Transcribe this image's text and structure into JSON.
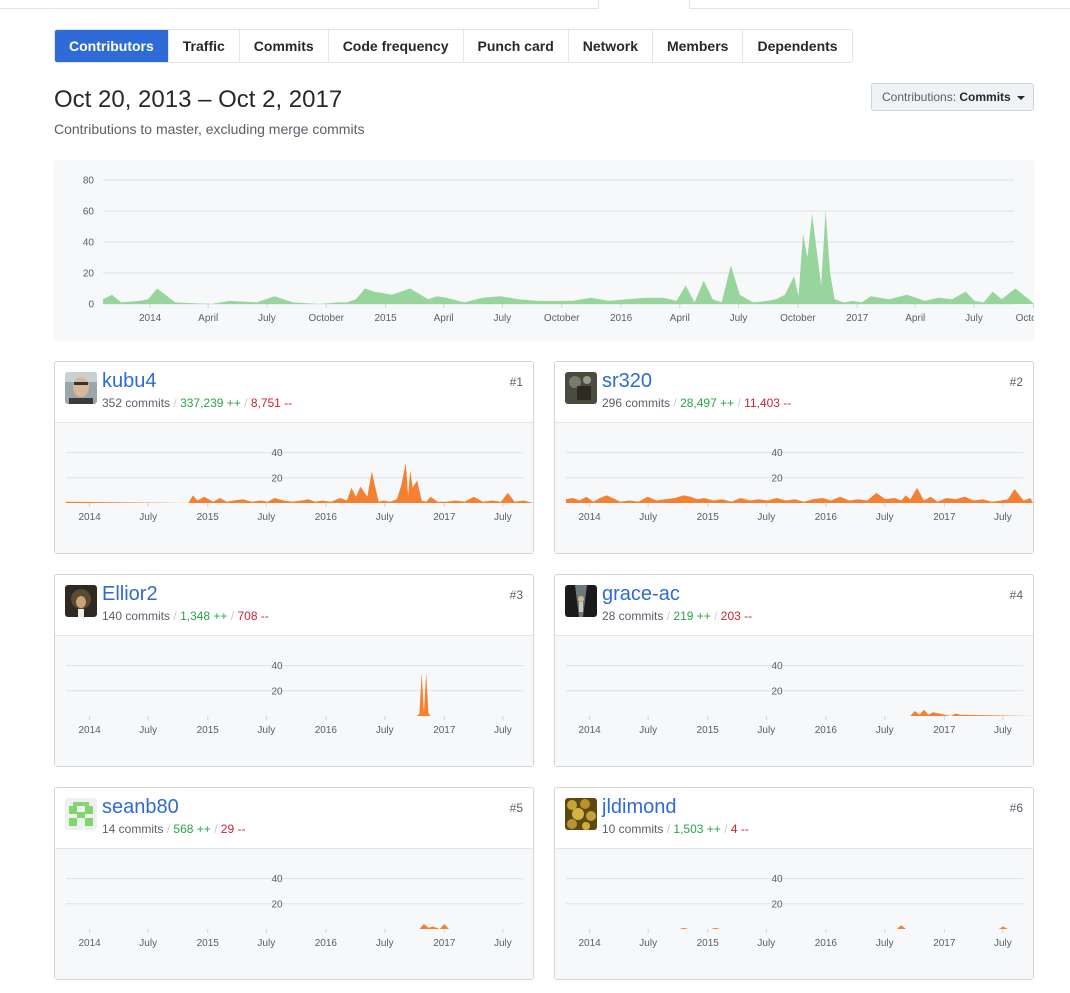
{
  "tabs": [
    {
      "label": "Contributors",
      "selected": true
    },
    {
      "label": "Traffic"
    },
    {
      "label": "Commits"
    },
    {
      "label": "Code frequency"
    },
    {
      "label": "Punch card"
    },
    {
      "label": "Network"
    },
    {
      "label": "Members"
    },
    {
      "label": "Dependents"
    }
  ],
  "header": {
    "date_range": "Oct 20, 2013 – Oct 2, 2017",
    "subtitle": "Contributions to master, excluding merge commits",
    "contributions_label": "Contributions:",
    "contributions_value": "Commits"
  },
  "chart_data": [
    {
      "type": "area",
      "title": "",
      "color": "#98d59c",
      "ylim": [
        0,
        80
      ],
      "y_ticks": [
        0,
        20,
        40,
        60,
        80
      ],
      "x_ticks": [
        "2014",
        "April",
        "July",
        "October",
        "2015",
        "April",
        "July",
        "October",
        "2016",
        "April",
        "July",
        "October",
        "2017",
        "April",
        "July",
        "October"
      ],
      "x_range": [
        "2013-10-20",
        "2017-10-02"
      ],
      "series": [
        {
          "x": [
            "2013-10-20",
            "2013-11-03",
            "2013-11-17",
            "2013-12-15",
            "2013-12-29",
            "2014-01-12",
            "2014-02-09",
            "2014-04-06",
            "2014-05-04",
            "2014-06-15",
            "2014-07-13",
            "2014-08-10",
            "2014-09-21",
            "2014-10-19",
            "2014-11-02",
            "2014-11-16",
            "2014-11-30",
            "2014-12-14",
            "2015-01-11",
            "2015-02-08",
            "2015-03-08",
            "2015-03-22",
            "2015-04-05",
            "2015-05-03",
            "2015-05-31",
            "2015-06-28",
            "2015-07-26",
            "2015-08-23",
            "2015-09-20",
            "2015-10-18",
            "2015-11-15",
            "2015-12-13",
            "2016-01-10",
            "2016-02-07",
            "2016-03-06",
            "2016-03-27",
            "2016-04-10",
            "2016-04-24",
            "2016-05-08",
            "2016-05-22",
            "2016-06-05",
            "2016-06-19",
            "2016-07-03",
            "2016-07-24",
            "2016-08-14",
            "2016-08-28",
            "2016-09-11",
            "2016-09-25",
            "2016-10-02",
            "2016-10-09",
            "2016-10-16",
            "2016-10-23",
            "2016-10-30",
            "2016-11-06",
            "2016-11-13",
            "2016-11-20",
            "2016-11-27",
            "2016-12-11",
            "2016-12-25",
            "2017-01-08",
            "2017-01-22",
            "2017-02-19",
            "2017-03-19",
            "2017-04-16",
            "2017-05-07",
            "2017-05-28",
            "2017-06-18",
            "2017-07-02",
            "2017-07-16",
            "2017-07-30",
            "2017-08-13",
            "2017-09-03",
            "2017-09-24",
            "2017-10-02"
          ],
          "y": [
            3,
            6,
            1,
            2,
            3,
            10,
            1,
            0,
            2,
            1,
            5,
            1,
            0,
            1,
            1,
            3,
            10,
            8,
            6,
            10,
            3,
            5,
            4,
            1,
            4,
            5,
            3,
            2,
            2,
            2,
            4,
            2,
            3,
            4,
            4,
            2,
            12,
            1,
            15,
            3,
            1,
            25,
            6,
            1,
            2,
            3,
            6,
            18,
            5,
            45,
            30,
            58,
            35,
            12,
            60,
            20,
            3,
            1,
            2,
            1,
            5,
            3,
            6,
            2,
            4,
            3,
            8,
            2,
            1,
            8,
            3,
            10,
            3,
            0
          ]
        }
      ]
    },
    {
      "type": "area",
      "color": "#f48032",
      "ylim": [
        0,
        50
      ],
      "y_ticks": [
        20,
        40
      ],
      "x_ticks": [
        "2014",
        "July",
        "2015",
        "July",
        "2016",
        "July",
        "2017",
        "July"
      ],
      "series": [
        {
          "name": "kubu4",
          "x": [
            "2013-10-20",
            "2014-11-02",
            "2014-11-16",
            "2014-11-30",
            "2014-12-21",
            "2015-01-18",
            "2015-02-08",
            "2015-03-01",
            "2015-03-22",
            "2015-04-19",
            "2015-05-17",
            "2015-06-14",
            "2015-07-05",
            "2015-07-26",
            "2015-08-23",
            "2015-09-20",
            "2015-10-18",
            "2015-11-08",
            "2015-11-29",
            "2015-12-20",
            "2016-01-17",
            "2016-02-14",
            "2016-03-06",
            "2016-03-20",
            "2016-04-03",
            "2016-04-17",
            "2016-05-08",
            "2016-05-22",
            "2016-06-12",
            "2016-06-26",
            "2016-07-17",
            "2016-08-07",
            "2016-08-21",
            "2016-09-04",
            "2016-09-11",
            "2016-09-18",
            "2016-09-25",
            "2016-10-09",
            "2016-10-23",
            "2016-11-06",
            "2016-11-20",
            "2016-12-11",
            "2017-01-08",
            "2017-02-05",
            "2017-03-05",
            "2017-04-02",
            "2017-04-30",
            "2017-05-28",
            "2017-06-25",
            "2017-07-16",
            "2017-08-06",
            "2017-09-03",
            "2017-10-02"
          ],
          "y": [
            1,
            0,
            6,
            2,
            5,
            1,
            4,
            1,
            2,
            3,
            1,
            2,
            1,
            4,
            2,
            1,
            2,
            3,
            1,
            2,
            1,
            4,
            2,
            12,
            5,
            13,
            5,
            25,
            1,
            2,
            1,
            3,
            14,
            32,
            6,
            26,
            12,
            18,
            2,
            1,
            5,
            1,
            1,
            2,
            1,
            5,
            1,
            2,
            1,
            8,
            1,
            2,
            0
          ]
        }
      ]
    },
    {
      "type": "area",
      "color": "#f48032",
      "ylim": [
        0,
        50
      ],
      "y_ticks": [
        20,
        40
      ],
      "x_ticks": [
        "2014",
        "July",
        "2015",
        "July",
        "2016",
        "July",
        "2017",
        "July"
      ],
      "series": [
        {
          "name": "sr320",
          "x": [
            "2013-10-20",
            "2013-11-10",
            "2013-12-01",
            "2013-12-22",
            "2014-01-12",
            "2014-02-02",
            "2014-02-23",
            "2014-04-06",
            "2014-05-04",
            "2014-06-01",
            "2014-06-29",
            "2014-07-27",
            "2014-08-24",
            "2014-09-21",
            "2014-10-19",
            "2014-11-09",
            "2014-11-30",
            "2014-12-21",
            "2015-01-18",
            "2015-02-15",
            "2015-03-15",
            "2015-04-12",
            "2015-05-10",
            "2015-06-07",
            "2015-07-05",
            "2015-08-02",
            "2015-08-30",
            "2015-09-27",
            "2015-10-25",
            "2015-11-22",
            "2015-12-20",
            "2016-01-17",
            "2016-02-14",
            "2016-03-13",
            "2016-04-10",
            "2016-05-08",
            "2016-06-05",
            "2016-07-03",
            "2016-07-31",
            "2016-08-21",
            "2016-09-04",
            "2016-09-18",
            "2016-10-09",
            "2016-10-30",
            "2016-11-20",
            "2016-12-11",
            "2017-01-08",
            "2017-02-05",
            "2017-03-05",
            "2017-04-02",
            "2017-04-30",
            "2017-05-28",
            "2017-06-25",
            "2017-07-16",
            "2017-08-06",
            "2017-09-03",
            "2017-09-24",
            "2017-10-02"
          ],
          "y": [
            3,
            4,
            2,
            5,
            1,
            4,
            6,
            1,
            2,
            1,
            5,
            2,
            3,
            4,
            6,
            5,
            3,
            4,
            2,
            3,
            1,
            4,
            2,
            3,
            2,
            4,
            2,
            3,
            1,
            3,
            4,
            2,
            5,
            2,
            3,
            2,
            8,
            3,
            4,
            2,
            6,
            3,
            12,
            2,
            5,
            1,
            4,
            3,
            5,
            2,
            3,
            1,
            2,
            3,
            11,
            2,
            4,
            0
          ]
        }
      ]
    },
    {
      "type": "area",
      "color": "#f48032",
      "ylim": [
        0,
        50
      ],
      "y_ticks": [
        20,
        40
      ],
      "x_ticks": [
        "2014",
        "July",
        "2015",
        "July",
        "2016",
        "July",
        "2017",
        "July"
      ],
      "series": [
        {
          "name": "Ellior2",
          "x": [
            "2013-10-20",
            "2016-10-09",
            "2016-10-16",
            "2016-10-23",
            "2016-10-30",
            "2016-11-06",
            "2016-11-13",
            "2016-11-20",
            "2017-10-02"
          ],
          "y": [
            0,
            0,
            2,
            34,
            3,
            34,
            2,
            0,
            0
          ]
        }
      ]
    },
    {
      "type": "area",
      "color": "#f48032",
      "ylim": [
        0,
        50
      ],
      "y_ticks": [
        20,
        40
      ],
      "x_ticks": [
        "2014",
        "July",
        "2015",
        "July",
        "2016",
        "July",
        "2017",
        "July"
      ],
      "series": [
        {
          "name": "grace-ac",
          "x": [
            "2013-10-20",
            "2016-09-18",
            "2016-10-02",
            "2016-10-16",
            "2016-10-30",
            "2016-11-13",
            "2016-11-27",
            "2017-01-22",
            "2017-02-05",
            "2017-02-19",
            "2017-10-02"
          ],
          "y": [
            0,
            0,
            4,
            1,
            5,
            1,
            3,
            0,
            2,
            1,
            0
          ]
        }
      ]
    },
    {
      "type": "area",
      "color": "#f48032",
      "ylim": [
        0,
        50
      ],
      "y_ticks": [
        20,
        40
      ],
      "x_ticks": [
        "2014",
        "July",
        "2015",
        "July",
        "2016",
        "July",
        "2017",
        "July"
      ],
      "series": [
        {
          "name": "seanb80",
          "x": [
            "2013-10-20",
            "2016-10-16",
            "2016-10-30",
            "2016-11-13",
            "2016-11-27",
            "2016-12-18",
            "2017-01-01",
            "2017-01-15",
            "2017-10-02"
          ],
          "y": [
            0,
            0,
            4,
            1,
            2,
            0,
            4,
            0,
            0
          ]
        }
      ]
    },
    {
      "type": "area",
      "color": "#f48032",
      "ylim": [
        0,
        50
      ],
      "y_ticks": [
        20,
        40
      ],
      "x_ticks": [
        "2014",
        "July",
        "2015",
        "July",
        "2016",
        "July",
        "2017",
        "July"
      ],
      "series": [
        {
          "name": "jldimond",
          "x": [
            "2013-10-20",
            "2014-10-05",
            "2014-10-19",
            "2014-11-02",
            "2015-01-11",
            "2015-01-25",
            "2015-02-08",
            "2016-08-07",
            "2016-08-21",
            "2016-09-04",
            "2017-06-18",
            "2017-07-02",
            "2017-07-16",
            "2017-10-02"
          ],
          "y": [
            0,
            0,
            1,
            0,
            0,
            1,
            0,
            0,
            3,
            0,
            0,
            2,
            0,
            0
          ]
        }
      ]
    }
  ],
  "contributors": [
    {
      "name": "kubu4",
      "rank": "#1",
      "commits": "352 commits",
      "additions": "337,239 ++",
      "deletions": "8,751 --"
    },
    {
      "name": "sr320",
      "rank": "#2",
      "commits": "296 commits",
      "additions": "28,497 ++",
      "deletions": "11,403 --"
    },
    {
      "name": "Ellior2",
      "rank": "#3",
      "commits": "140 commits",
      "additions": "1,348 ++",
      "deletions": "708 --"
    },
    {
      "name": "grace-ac",
      "rank": "#4",
      "commits": "28 commits",
      "additions": "219 ++",
      "deletions": "203 --"
    },
    {
      "name": "seanb80",
      "rank": "#5",
      "commits": "14 commits",
      "additions": "568 ++",
      "deletions": "29 --"
    },
    {
      "name": "jldimond",
      "rank": "#6",
      "commits": "10 commits",
      "additions": "1,503 ++",
      "deletions": "4 --"
    }
  ]
}
